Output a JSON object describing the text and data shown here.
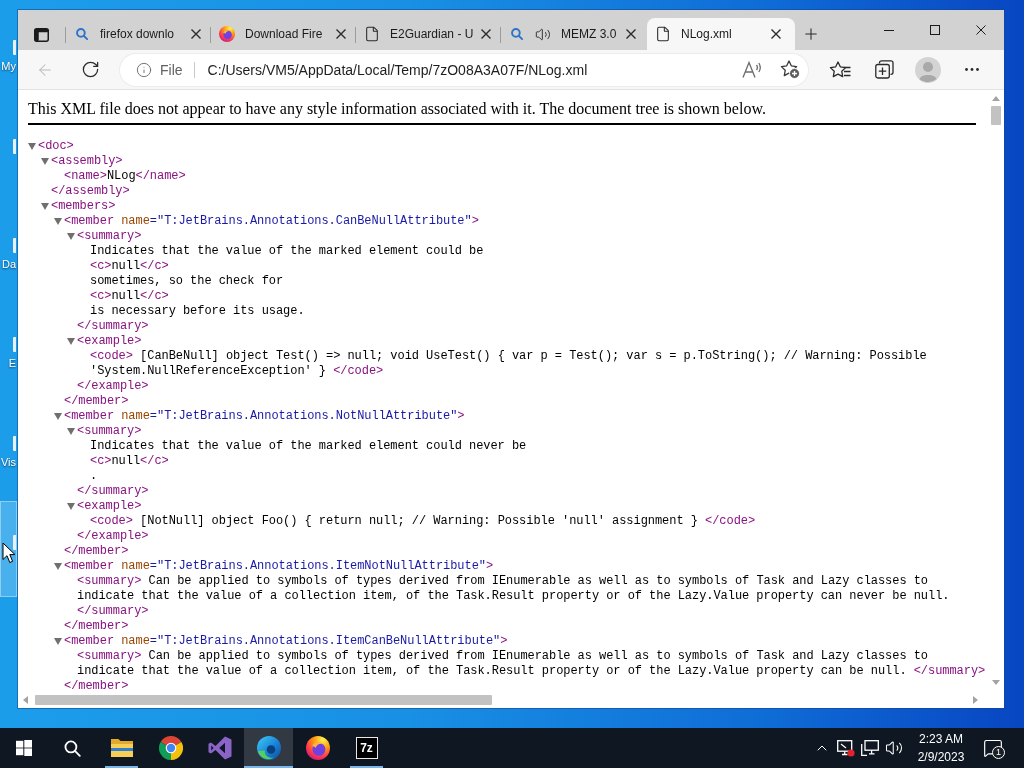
{
  "desktop": {
    "icons": [
      {
        "label": "My",
        "selected": false
      },
      {
        "selected": false
      },
      {
        "label": "Da",
        "selected": false
      },
      {
        "label": "E",
        "selected": false
      },
      {
        "label": "Vis",
        "selected": false
      },
      {
        "selected": true
      }
    ]
  },
  "browser": {
    "tabs": [
      {
        "title": "firefox downlo",
        "kind": "search",
        "audio": false,
        "selected": false
      },
      {
        "title": "Download Fire",
        "kind": "fox",
        "audio": false,
        "selected": false
      },
      {
        "title": "E2Guardian - U",
        "kind": "page",
        "audio": false,
        "selected": false
      },
      {
        "title": "MEMZ 3.0",
        "kind": "search",
        "audio": true,
        "selected": false
      },
      {
        "title": "NLog.xml",
        "kind": "page",
        "audio": false,
        "selected": true
      }
    ],
    "toolbar": {
      "back": {
        "disabled": true
      },
      "site_label": "File",
      "url": "C:/Users/VM5/AppData/Local/Temp/7zO08A3A07F/NLog.xml"
    }
  },
  "xml_viewer": {
    "notice": "This XML file does not appear to have any style information associated with it. The document tree is shown below.",
    "tree": {
      "kind": "element",
      "open": "<doc>",
      "expanded": true,
      "children": [
        {
          "kind": "element",
          "open": "<assembly>",
          "expanded": true,
          "children": [
            {
              "kind": "leaf",
              "open": "<name>",
              "text": "NLog",
              "close": "</name>"
            }
          ],
          "close": "</assembly>"
        },
        {
          "kind": "element",
          "open": "<members>",
          "expanded": true,
          "children": [
            {
              "kind": "element",
              "open": "<member",
              "attributes": [
                {
                  "name": "name",
                  "value": "=\"T:JetBrains.Annotations.CanBeNullAttribute\""
                }
              ],
              "open_end": ">",
              "expanded": true,
              "children": [
                {
                  "kind": "element",
                  "open": "<summary>",
                  "expanded": true,
                  "children": [
                    {
                      "kind": "text",
                      "text": "Indicates that the value of the marked element could be"
                    },
                    {
                      "kind": "leaf",
                      "open": "<c>",
                      "text": "null",
                      "close": "</c>"
                    },
                    {
                      "kind": "text",
                      "text": "sometimes, so the check for"
                    },
                    {
                      "kind": "leaf",
                      "open": "<c>",
                      "text": "null",
                      "close": "</c>"
                    },
                    {
                      "kind": "text",
                      "text": "is necessary before its usage."
                    }
                  ],
                  "close": "</summary>"
                },
                {
                  "kind": "element",
                  "open": "<example>",
                  "expanded": true,
                  "children": [
                    {
                      "kind": "leaf",
                      "open": "<code>",
                      "text": " [CanBeNull] object Test() => null; void UseTest() { var p = Test(); var s = p.ToString(); // Warning: Possible 'System.NullReferenceException' } ",
                      "close": "</code>"
                    }
                  ],
                  "close": "</example>"
                }
              ],
              "close": "</member>"
            },
            {
              "kind": "element",
              "open": "<member",
              "attributes": [
                {
                  "name": "name",
                  "value": "=\"T:JetBrains.Annotations.NotNullAttribute\""
                }
              ],
              "open_end": ">",
              "expanded": true,
              "children": [
                {
                  "kind": "element",
                  "open": "<summary>",
                  "expanded": true,
                  "children": [
                    {
                      "kind": "text",
                      "text": "Indicates that the value of the marked element could never be"
                    },
                    {
                      "kind": "leaf",
                      "open": "<c>",
                      "text": "null",
                      "close": "</c>"
                    },
                    {
                      "kind": "text",
                      "text": "."
                    }
                  ],
                  "close": "</summary>"
                },
                {
                  "kind": "element",
                  "open": "<example>",
                  "expanded": true,
                  "children": [
                    {
                      "kind": "leaf",
                      "open": "<code>",
                      "text": " [NotNull] object Foo() { return null; // Warning: Possible 'null' assignment } ",
                      "close": "</code>"
                    }
                  ],
                  "close": "</example>"
                }
              ],
              "close": "</member>"
            },
            {
              "kind": "element",
              "open": "<member",
              "attributes": [
                {
                  "name": "name",
                  "value": "=\"T:JetBrains.Annotations.ItemNotNullAttribute\""
                }
              ],
              "open_end": ">",
              "expanded": true,
              "children": [
                {
                  "kind": "leaf",
                  "open": "<summary>",
                  "text": " Can be applied to symbols of types derived from IEnumerable as well as to symbols of Task and Lazy classes to indicate that the value of a collection item, of the Task.Result property or of the Lazy.Value property can never be null. ",
                  "close": "</summary>"
                }
              ],
              "close": "</member>"
            },
            {
              "kind": "element",
              "open": "<member",
              "attributes": [
                {
                  "name": "name",
                  "value": "=\"T:JetBrains.Annotations.ItemCanBeNullAttribute\""
                }
              ],
              "open_end": ">",
              "expanded": true,
              "children": [
                {
                  "kind": "leaf",
                  "open": "<summary>",
                  "text": " Can be applied to symbols of types derived from IEnumerable as well as to symbols of Task and Lazy classes to indicate that the value of a collection item, of the Task.Result property or of the Lazy.Value property can be null. ",
                  "close": "</summary>"
                }
              ],
              "close": "</member>"
            }
          ]
        }
      ]
    }
  },
  "taskbar": {
    "apps": [
      {
        "kind": "folder",
        "running": true,
        "selected": false
      },
      {
        "kind": "circle",
        "running": false,
        "selected": false
      },
      {
        "kind": "ribbon",
        "running": false,
        "selected": false
      },
      {
        "kind": "wave",
        "running": true,
        "selected": true
      },
      {
        "kind": "fox",
        "running": false,
        "selected": false
      },
      {
        "kind": "archive",
        "label": "7z",
        "running": true,
        "selected": false
      }
    ],
    "clock": {
      "time": "2:23 AM",
      "date": "2/9/2023"
    },
    "notifications": "1"
  }
}
